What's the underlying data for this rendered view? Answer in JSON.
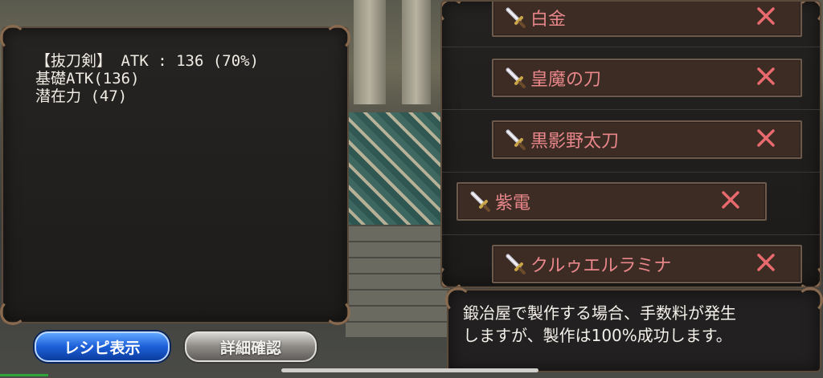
{
  "stats": {
    "line1": "【抜刀剣】 ATK : 136 (70%)",
    "line2": "基礎ATK(136)",
    "line3": "潜在力 (47)"
  },
  "weapon_list": [
    {
      "name": "白金",
      "icon": "sword-icon",
      "remove_icon": "close-icon"
    },
    {
      "name": "皇魔の刀",
      "icon": "sword-icon",
      "remove_icon": "close-icon"
    },
    {
      "name": "黒影野太刀",
      "icon": "sword-icon",
      "remove_icon": "close-icon"
    },
    {
      "name": "紫電",
      "icon": "sword-icon",
      "remove_icon": "close-icon",
      "selected": true
    },
    {
      "name": "クルゥエルラミナ",
      "icon": "sword-icon",
      "remove_icon": "close-icon"
    }
  ],
  "description": {
    "line1": "鍛冶屋で製作する場合、手数料が発生",
    "line2": "しますが、製作は100%成功します。"
  },
  "buttons": {
    "recipe": "レシピ表示",
    "detail": "詳細確認"
  },
  "colors": {
    "item_text": "#e8868a",
    "close_x": "#e8696e",
    "recipe_button": "#1d5fd8",
    "detail_button": "#8d8a86"
  }
}
